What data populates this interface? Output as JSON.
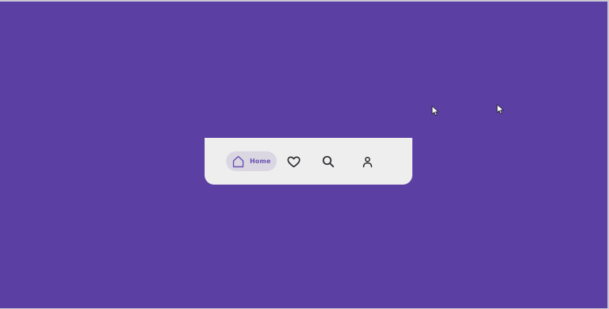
{
  "colors": {
    "background": "#5b3fa3",
    "navbar_bg": "#eeeeef",
    "active_pill_bg": "#dad7e3",
    "active_accent": "#6a4fb0",
    "icon_color": "#2b2b2f"
  },
  "nav": {
    "items": [
      {
        "label": "Home",
        "icon": "home-icon",
        "active": true
      },
      {
        "label": "",
        "icon": "heart-icon",
        "active": false
      },
      {
        "label": "",
        "icon": "search-icon",
        "active": false
      },
      {
        "label": "",
        "icon": "user-icon",
        "active": false
      }
    ]
  },
  "cursors": [
    {
      "icon": "mouse-pointer-icon"
    },
    {
      "icon": "mouse-pointer-icon"
    }
  ]
}
